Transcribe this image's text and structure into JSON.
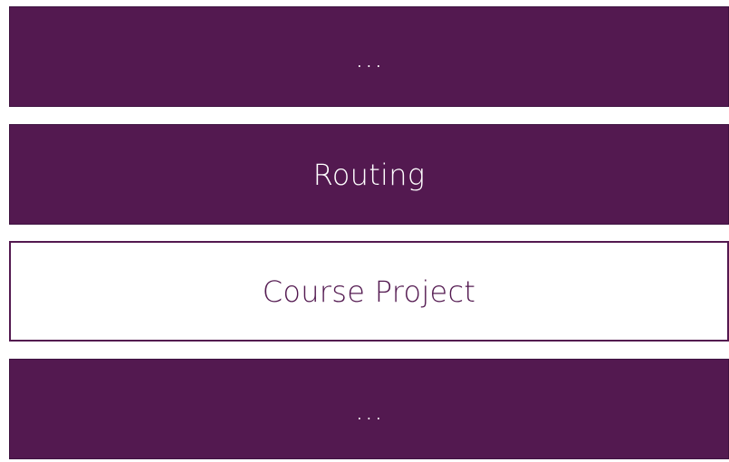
{
  "colors": {
    "accent": "#531950",
    "text_on_accent": "#FFFFFF",
    "background": "#FFFFFF"
  },
  "blocks": [
    {
      "label": "...",
      "style": "filled"
    },
    {
      "label": "Routing",
      "style": "filled"
    },
    {
      "label": "Course Project",
      "style": "outlined"
    },
    {
      "label": "...",
      "style": "filled"
    }
  ]
}
